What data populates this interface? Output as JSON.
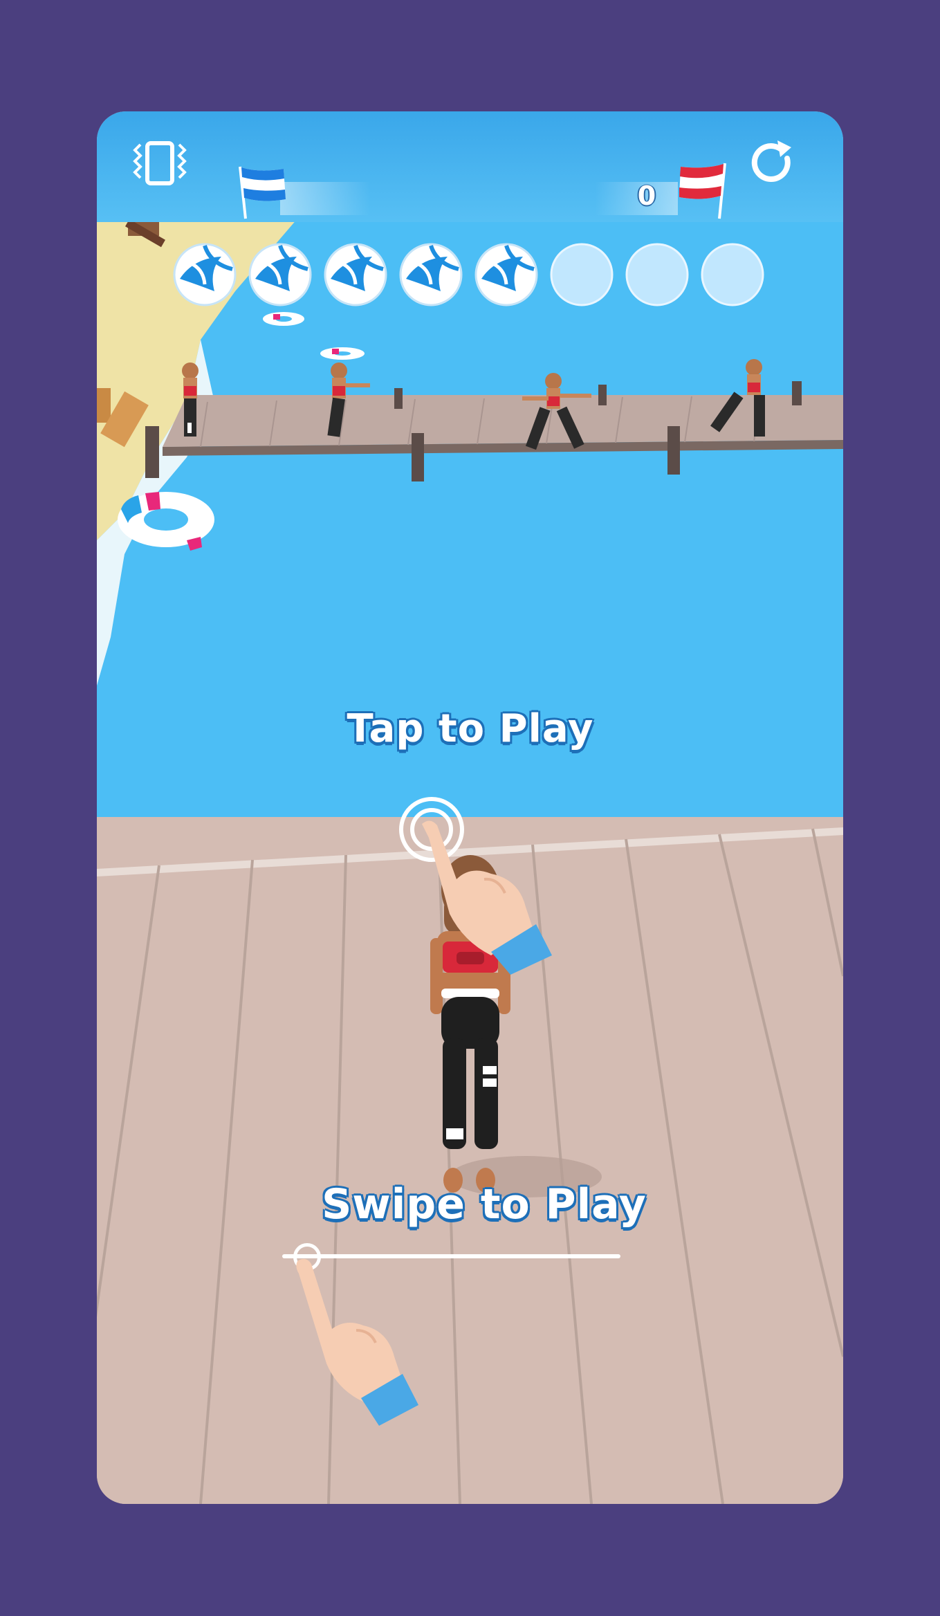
{
  "score": "0",
  "prompts": {
    "tap": "Tap to Play",
    "swipe": "Swipe to Play"
  },
  "balls": {
    "filled": 5,
    "total": 8
  },
  "icons": {
    "vibrate": "vibrate-icon",
    "restart": "restart-icon",
    "left_flag": "blue-white-flag-icon",
    "right_flag": "red-white-flag-icon",
    "ball": "volleyball-icon",
    "tap_hand": "tap-hand-icon",
    "swipe_hand": "swipe-hand-icon"
  },
  "colors": {
    "background": "#4b3f7f",
    "water": "#4fc1f6",
    "deck": "#d4bcb3",
    "topbar": "#3aa7ea",
    "text_outline": "#1d6fb8"
  }
}
